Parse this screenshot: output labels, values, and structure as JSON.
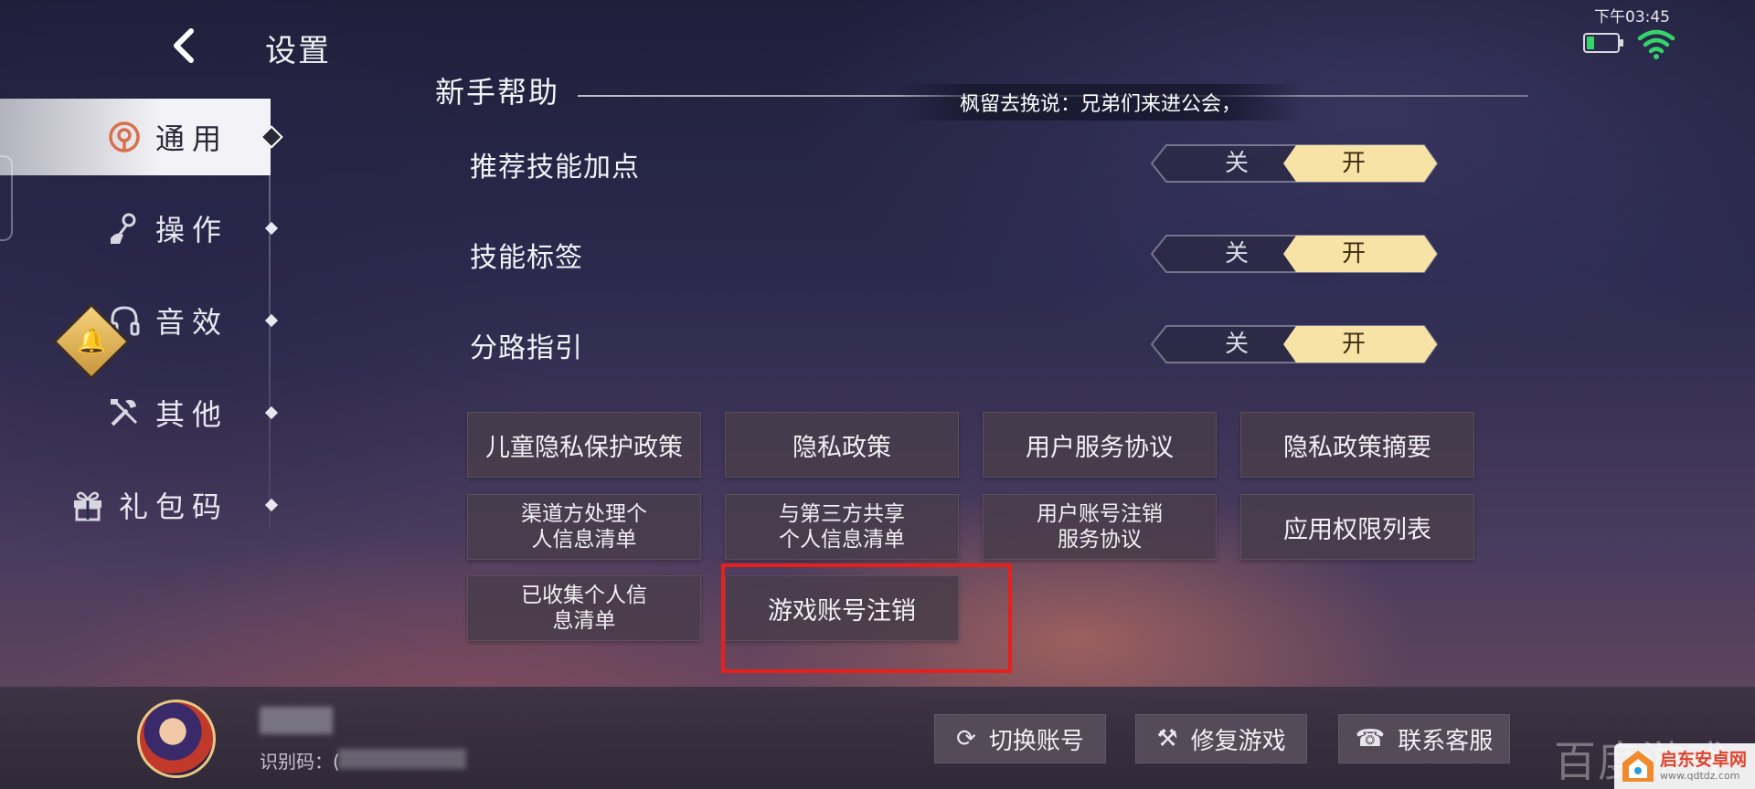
{
  "status": {
    "time": "下午03:45",
    "battery_level": 0.25,
    "battery_color": "#35d46a",
    "wifi_color": "#35d46a"
  },
  "header": {
    "title": "设置",
    "back_icon": "chevron-left-icon"
  },
  "sidebar": {
    "active_index": 0,
    "items": [
      {
        "label": "通用",
        "icon": "general-icon"
      },
      {
        "label": "操作",
        "icon": "joystick-icon"
      },
      {
        "label": "音效",
        "icon": "headphones-icon"
      },
      {
        "label": "其他",
        "icon": "tools-icon"
      },
      {
        "label": "礼包码",
        "icon": "gift-icon"
      }
    ],
    "notification_icon": "bell-icon"
  },
  "section": {
    "title": "新手帮助",
    "ticker": "枫留去挽说：兄弟们来进公会，"
  },
  "settings": [
    {
      "label": "推荐技能加点",
      "off_label": "关",
      "on_label": "开",
      "value": "on"
    },
    {
      "label": "技能标签",
      "off_label": "关",
      "on_label": "开",
      "value": "on"
    },
    {
      "label": "分路指引",
      "off_label": "关",
      "on_label": "开",
      "value": "on"
    }
  ],
  "policy_buttons": [
    "儿童隐私保护政策",
    "隐私政策",
    "用户服务协议",
    "隐私政策摘要",
    "渠道方处理个\n人信息清单",
    "与第三方共享\n个人信息清单",
    "用户账号注销\n服务协议",
    "应用权限列表",
    "已收集个人信\n息清单",
    "游戏账号注销"
  ],
  "highlight": {
    "target": "游戏账号注销",
    "color": "#e8201c"
  },
  "footer": {
    "id_label": "识别码：(",
    "actions": [
      {
        "label": "切换账号",
        "icon": "switch-account-icon"
      },
      {
        "label": "修复游戏",
        "icon": "repair-icon"
      },
      {
        "label": "联系客服",
        "icon": "customer-service-icon"
      }
    ]
  },
  "watermark": {
    "text_a": "百度游戏",
    "text_b": "启东安卓网",
    "text_c": "www.qdtdz.com"
  },
  "colors": {
    "toggle_on": "#f7e3a6",
    "accent_gold": "#e6c783",
    "text": "#f2f2f6"
  }
}
